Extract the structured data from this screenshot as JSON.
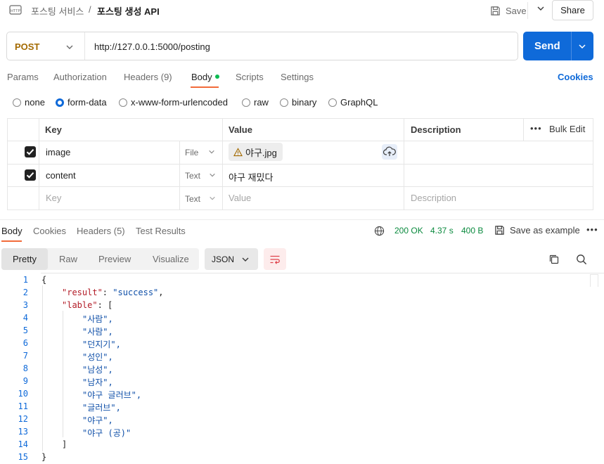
{
  "breadcrumb": {
    "collection": "포스팅 서비스",
    "separator": "/",
    "request": "포스팅 생성 API"
  },
  "header": {
    "save_label": "Save",
    "share_label": "Share"
  },
  "request": {
    "method": "POST",
    "url": "http://127.0.0.1:5000/posting",
    "send_label": "Send"
  },
  "tabs": [
    {
      "label": "Params"
    },
    {
      "label": "Authorization"
    },
    {
      "label": "Headers (9)"
    },
    {
      "label": "Body"
    },
    {
      "label": "Scripts"
    },
    {
      "label": "Settings"
    }
  ],
  "cookies_label": "Cookies",
  "body_types": [
    {
      "label": "none",
      "selected": false
    },
    {
      "label": "form-data",
      "selected": true
    },
    {
      "label": "x-www-form-urlencoded",
      "selected": false
    },
    {
      "label": "raw",
      "selected": false
    },
    {
      "label": "binary",
      "selected": false
    },
    {
      "label": "GraphQL",
      "selected": false
    }
  ],
  "params_table": {
    "headers": {
      "key": "Key",
      "value": "Value",
      "description": "Description",
      "bulk_edit": "Bulk Edit"
    },
    "rows": [
      {
        "checked": true,
        "key": "image",
        "type": "File",
        "value": "야구.jpg"
      },
      {
        "checked": true,
        "key": "content",
        "type": "Text",
        "value": "야구 재밌다"
      }
    ],
    "placeholder": {
      "key": "Key",
      "type": "Text",
      "value": "Value",
      "description": "Description"
    }
  },
  "response": {
    "tabs": [
      {
        "label": "Body"
      },
      {
        "label": "Cookies"
      },
      {
        "label": "Headers (5)"
      },
      {
        "label": "Test Results"
      }
    ],
    "status": "200 OK",
    "time": "4.37 s",
    "size": "400 B",
    "save_example": "Save as example",
    "views": [
      {
        "label": "Pretty"
      },
      {
        "label": "Raw"
      },
      {
        "label": "Preview"
      },
      {
        "label": "Visualize"
      }
    ],
    "format": "JSON",
    "line_numbers": [
      "1",
      "2",
      "3",
      "4",
      "5",
      "6",
      "7",
      "8",
      "9",
      "10",
      "11",
      "12",
      "13",
      "14",
      "15"
    ],
    "code": {
      "open_brace": "{",
      "result_key": "\"result\"",
      "result_colon": ": ",
      "result_value": "\"success\"",
      "result_comma": ",",
      "lable_key": "\"lable\"",
      "lable_open": ": [",
      "items": [
        "\"사람\",",
        "\"사람\",",
        "\"던지기\",",
        "\"성인\",",
        "\"남성\",",
        "\"남자\",",
        "\"야구 글러브\",",
        "\"글러브\",",
        "\"야구\",",
        "\"야구 (공)\""
      ],
      "close_bracket": "]",
      "close_brace": "}"
    }
  },
  "colors": {
    "accent": "#0f6ad9",
    "tab_underline": "#f26b3a",
    "status_ok": "#0a8a3e",
    "method": "#a36a00"
  }
}
